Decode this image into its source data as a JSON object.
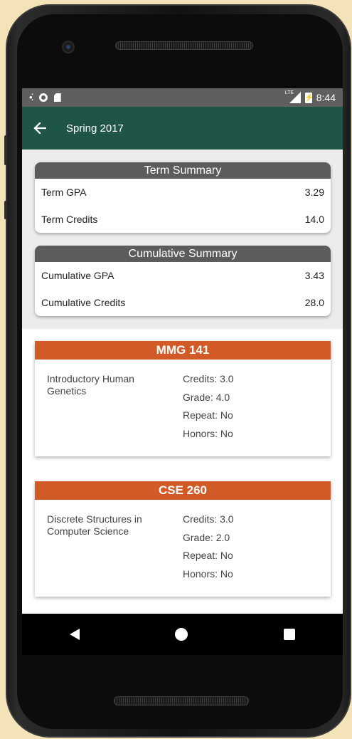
{
  "status_bar": {
    "time": "8:44",
    "network": "LTE"
  },
  "app_bar": {
    "title": "Spring 2017"
  },
  "term_summary": {
    "title": "Term Summary",
    "rows": [
      {
        "label": "Term GPA",
        "value": "3.29"
      },
      {
        "label": "Term Credits",
        "value": "14.0"
      }
    ]
  },
  "cumulative_summary": {
    "title": "Cumulative Summary",
    "rows": [
      {
        "label": "Cumulative GPA",
        "value": "3.43"
      },
      {
        "label": "Cumulative Credits",
        "value": "28.0"
      }
    ]
  },
  "courses": [
    {
      "code": "MMG 141",
      "name": "Introductory Human Genetics",
      "credits": "Credits: 3.0",
      "grade": "Grade: 4.0",
      "repeat": "Repeat: No",
      "honors": "Honors: No"
    },
    {
      "code": "CSE 260",
      "name": "Discrete Structures in Computer Science",
      "credits": "Credits: 3.0",
      "grade": "Grade: 2.0",
      "repeat": "Repeat: No",
      "honors": "Honors: No"
    }
  ],
  "colors": {
    "app_bar": "#1f5548",
    "card_header": "#5c5c5c",
    "course_header": "#d25a27",
    "status_bar": "#5f5f5f"
  }
}
